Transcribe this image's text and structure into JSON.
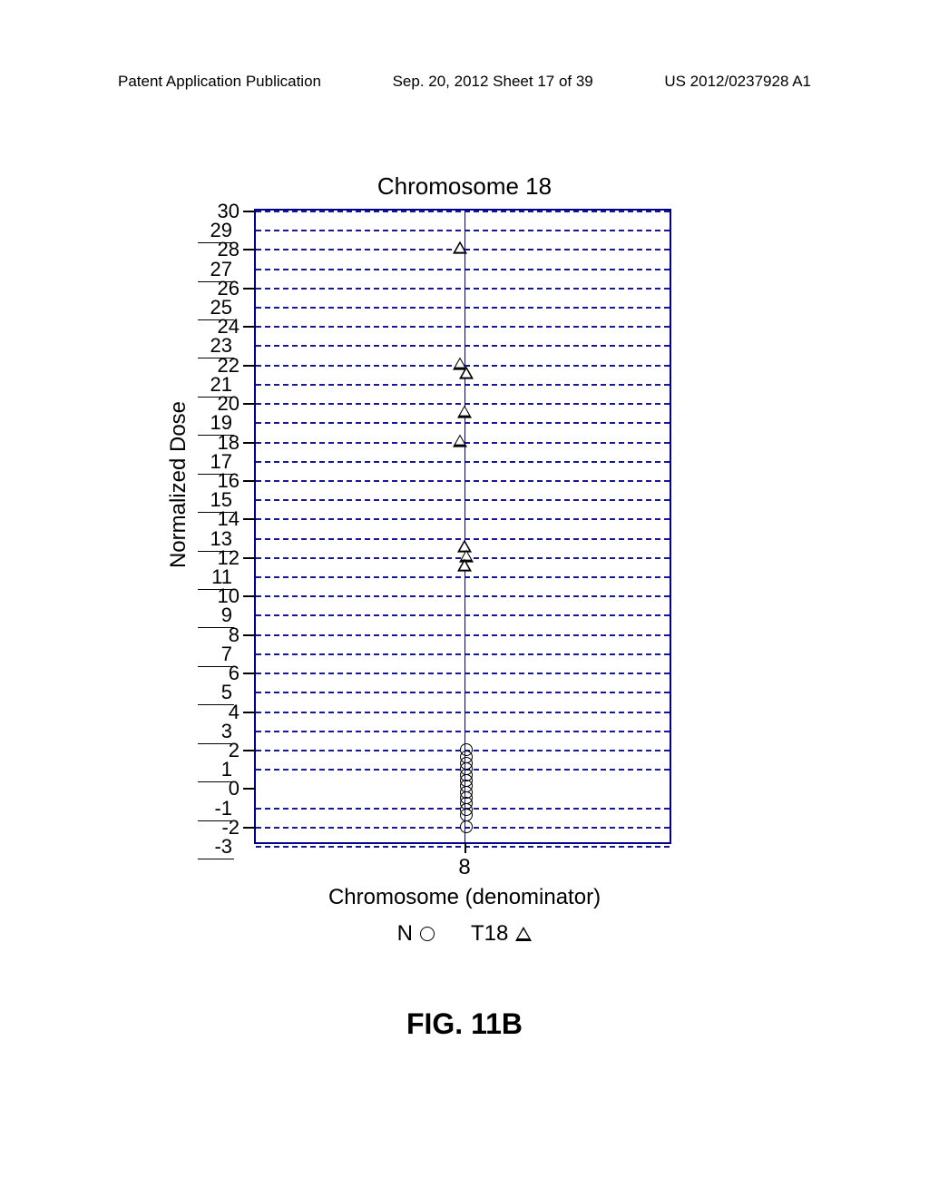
{
  "header": {
    "left": "Patent Application Publication",
    "mid": "Sep. 20, 2012  Sheet 17 of 39",
    "right": "US 2012/0237928 A1"
  },
  "figure_caption": "FIG. 11B",
  "chart_data": {
    "type": "scatter",
    "title": "Chromosome 18",
    "ylabel": "Normalized Dose",
    "xlabel": "Chromosome (denominator)",
    "ylim": [
      -3,
      30
    ],
    "xticks": [
      {
        "pos": 0.5,
        "label": "8"
      }
    ],
    "yticks_even": [
      -2,
      0,
      2,
      4,
      6,
      8,
      10,
      12,
      14,
      16,
      18,
      20,
      22,
      24,
      26,
      28,
      30
    ],
    "yticks_odd": [
      -3,
      -1,
      1,
      3,
      5,
      7,
      9,
      11,
      13,
      15,
      17,
      19,
      21,
      23,
      25,
      27,
      29
    ],
    "gridlines": [
      -3,
      -2,
      -1,
      1,
      2,
      3,
      4,
      5,
      6,
      7,
      8,
      9,
      10,
      11,
      12,
      13,
      14,
      15,
      16,
      17,
      18,
      19,
      20,
      21,
      22,
      23,
      24,
      25,
      26,
      27,
      28,
      29,
      30
    ],
    "series": [
      {
        "name": "N",
        "marker": "circle",
        "points": [
          {
            "x": 0.505,
            "y": 2.0
          },
          {
            "x": 0.505,
            "y": 1.6
          },
          {
            "x": 0.505,
            "y": 1.3
          },
          {
            "x": 0.505,
            "y": 1.0
          },
          {
            "x": 0.505,
            "y": 0.7
          },
          {
            "x": 0.505,
            "y": 0.4
          },
          {
            "x": 0.505,
            "y": 0.1
          },
          {
            "x": 0.505,
            "y": -0.2
          },
          {
            "x": 0.505,
            "y": -0.5
          },
          {
            "x": 0.505,
            "y": -0.8
          },
          {
            "x": 0.505,
            "y": -1.1
          },
          {
            "x": 0.505,
            "y": -1.4
          },
          {
            "x": 0.505,
            "y": -2.0
          }
        ]
      },
      {
        "name": "T18",
        "marker": "triangle",
        "points": [
          {
            "x": 0.49,
            "y": 28.0
          },
          {
            "x": 0.49,
            "y": 22.0
          },
          {
            "x": 0.505,
            "y": 21.5
          },
          {
            "x": 0.5,
            "y": 19.5
          },
          {
            "x": 0.49,
            "y": 18.0
          },
          {
            "x": 0.5,
            "y": 12.5
          },
          {
            "x": 0.505,
            "y": 12.0
          },
          {
            "x": 0.5,
            "y": 11.5
          }
        ]
      }
    ],
    "legend": [
      {
        "label": "N",
        "marker": "circle"
      },
      {
        "label": "T18",
        "marker": "triangle"
      }
    ]
  }
}
